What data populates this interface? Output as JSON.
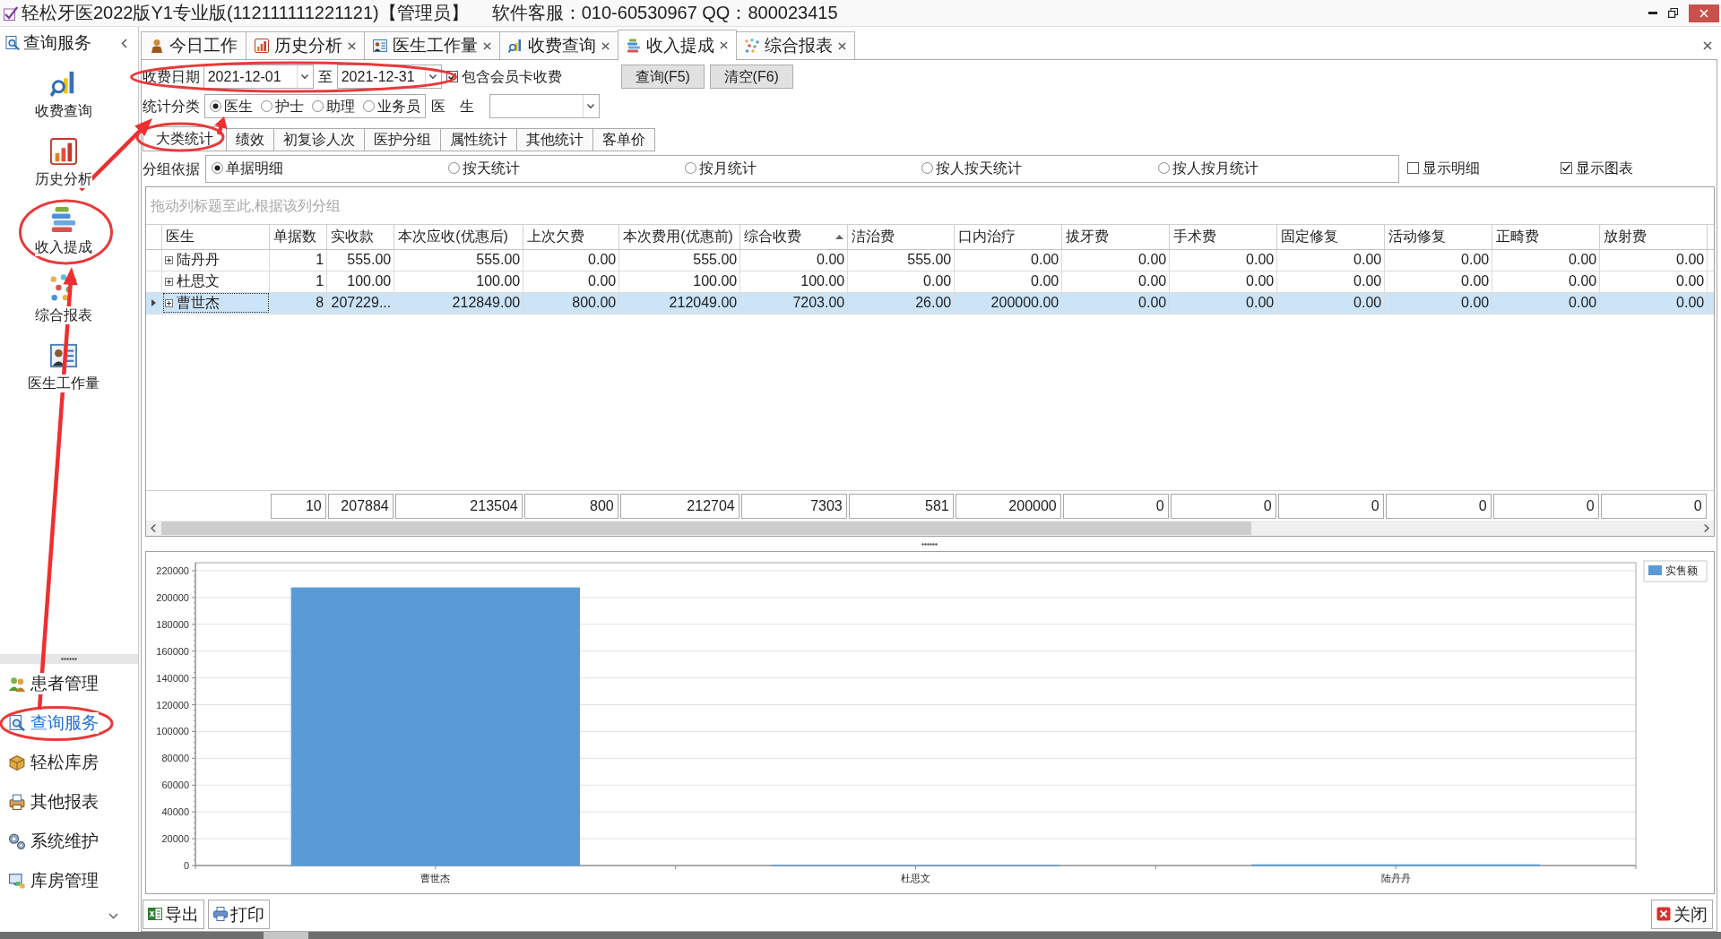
{
  "window": {
    "title": "轻松牙医2022版Y1专业版(112111111221121)【管理员】",
    "support": "软件客服：010-60530967 QQ：800023415"
  },
  "sidebar": {
    "header": "查询服务",
    "items": [
      "收费查询",
      "历史分析",
      "收入提成",
      "综合报表",
      "医生工作量"
    ],
    "nav": [
      {
        "label": "患者管理",
        "selected": false
      },
      {
        "label": "查询服务",
        "selected": true
      },
      {
        "label": "轻松库房",
        "selected": false
      },
      {
        "label": "其他报表",
        "selected": false
      },
      {
        "label": "系统维护",
        "selected": false
      },
      {
        "label": "库房管理",
        "selected": false
      }
    ]
  },
  "tabs": [
    {
      "label": "今日工作",
      "closable": false,
      "selected": false
    },
    {
      "label": "历史分析",
      "closable": true,
      "selected": false
    },
    {
      "label": "医生工作量",
      "closable": true,
      "selected": false
    },
    {
      "label": "收费查询",
      "closable": true,
      "selected": false
    },
    {
      "label": "收入提成",
      "closable": true,
      "selected": true
    },
    {
      "label": "综合报表",
      "closable": true,
      "selected": false
    }
  ],
  "filters": {
    "date_label": "收费日期",
    "date_from": "2021-12-01",
    "date_separator": "至",
    "date_to": "2021-12-31",
    "member_card": {
      "label": "包含会员卡收费",
      "checked": true
    },
    "buttons": [
      "查询(F5)",
      "清空(F6)"
    ],
    "category": {
      "label": "统计分类",
      "options": [
        {
          "label": "医生",
          "selected": true
        },
        {
          "label": "护士",
          "selected": false
        },
        {
          "label": "助理",
          "selected": false
        },
        {
          "label": "业务员",
          "selected": false
        }
      ]
    },
    "doctor": {
      "label": "医　生"
    }
  },
  "subtabs": [
    {
      "label": "大类统计",
      "selected": true
    },
    {
      "label": "绩效",
      "selected": false
    },
    {
      "label": "初复诊人次",
      "selected": false
    },
    {
      "label": "医护分组",
      "selected": false
    },
    {
      "label": "属性统计",
      "selected": false
    },
    {
      "label": "其他统计",
      "selected": false
    },
    {
      "label": "客单价",
      "selected": false
    }
  ],
  "grouping": {
    "label": "分组依据",
    "options": [
      {
        "label": "单据明细",
        "selected": true
      },
      {
        "label": "按天统计",
        "selected": false
      },
      {
        "label": "按月统计",
        "selected": false
      },
      {
        "label": "按人按天统计",
        "selected": false
      },
      {
        "label": "按人按月统计",
        "selected": false
      }
    ],
    "show_detail": {
      "label": "显示明细",
      "checked": false
    },
    "show_chart": {
      "label": "显示图表",
      "checked": true
    }
  },
  "grid": {
    "group_hint": "拖动列标题至此,根据该列分组",
    "columns": [
      {
        "label": "医生",
        "sorted": false
      },
      {
        "label": "单据数",
        "sorted": false
      },
      {
        "label": "实收款",
        "sorted": false
      },
      {
        "label": "本次应收(优惠后)",
        "sorted": false
      },
      {
        "label": "上次欠费",
        "sorted": false
      },
      {
        "label": "本次费用(优惠前)",
        "sorted": false
      },
      {
        "label": "综合收费",
        "sorted": true
      },
      {
        "label": "洁治费",
        "sorted": false
      },
      {
        "label": "口内治疗",
        "sorted": false
      },
      {
        "label": "拔牙费",
        "sorted": false
      },
      {
        "label": "手术费",
        "sorted": false
      },
      {
        "label": "固定修复",
        "sorted": false
      },
      {
        "label": "活动修复",
        "sorted": false
      },
      {
        "label": "正畸费",
        "sorted": false
      },
      {
        "label": "放射费",
        "sorted": false
      }
    ],
    "rows": [
      {
        "cells": [
          "陆丹丹",
          "1",
          "555.00",
          "555.00",
          "0.00",
          "555.00",
          "0.00",
          "555.00",
          "0.00",
          "0.00",
          "0.00",
          "0.00",
          "0.00",
          "0.00",
          "0.00"
        ],
        "selected": false,
        "expanded": false
      },
      {
        "cells": [
          "杜思文",
          "1",
          "100.00",
          "100.00",
          "0.00",
          "100.00",
          "100.00",
          "0.00",
          "0.00",
          "0.00",
          "0.00",
          "0.00",
          "0.00",
          "0.00",
          "0.00"
        ],
        "selected": false,
        "expanded": false
      },
      {
        "cells": [
          "曹世杰",
          "8",
          "207229...",
          "212849.00",
          "800.00",
          "212049.00",
          "7203.00",
          "26.00",
          "200000.00",
          "0.00",
          "0.00",
          "0.00",
          "0.00",
          "0.00",
          "0.00"
        ],
        "selected": true,
        "expanded": false
      }
    ],
    "totals": [
      "10",
      "207884",
      "213504",
      "800",
      "212704",
      "7303",
      "581",
      "200000",
      "0",
      "0",
      "0",
      "0",
      "0",
      "0"
    ]
  },
  "chart": {
    "chart_data": {
      "type": "bar",
      "categories": [
        "曹世杰",
        "杜思文",
        "陆丹丹"
      ],
      "series": [
        {
          "name": "实售额",
          "color": "#5b9bd5",
          "values": [
            207229,
            100,
            555
          ]
        }
      ],
      "ylim": [
        0,
        226000
      ],
      "yticks": [
        0,
        20000,
        40000,
        60000,
        80000,
        100000,
        120000,
        140000,
        160000,
        180000,
        200000,
        220000
      ],
      "grid": true
    }
  },
  "footer": {
    "buttons": [
      "导出",
      "打印"
    ],
    "close": "关闭"
  }
}
